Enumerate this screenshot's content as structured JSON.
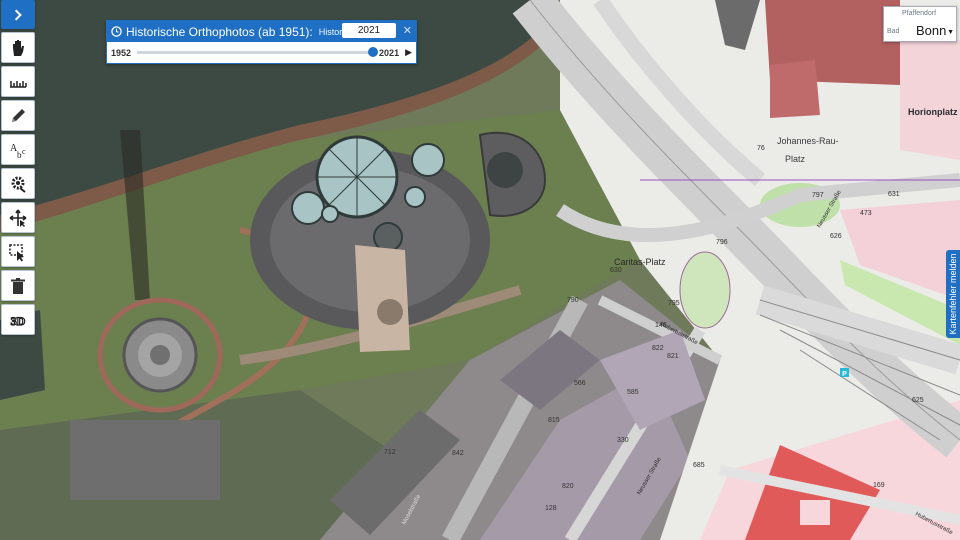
{
  "map": {
    "place_labels": {
      "johannes": "Johannes-Rau-",
      "platz": "Platz",
      "horionplatz": "Horionplatz",
      "caritas": "Caritas-Platz",
      "huberstrasse1": "Hubertusstraße",
      "huberstrasse2": "Hubertusstraße",
      "neusser1": "Neusser Straße",
      "neusser2": "Neusser Straße",
      "mosel": "Moselstraße"
    },
    "house_numbers": [
      "631",
      "473",
      "626",
      "797",
      "796",
      "795",
      "146",
      "822",
      "821",
      "585",
      "566",
      "815",
      "330",
      "685",
      "625",
      "842",
      "712",
      "820",
      "128",
      "169",
      "790",
      "630",
      "76"
    ],
    "parking_label": "P"
  },
  "toolbar": {
    "tools": [
      "expand-icon",
      "hand-icon",
      "measure-icon",
      "pencil-icon",
      "text-icon",
      "settings-icon",
      "move-icon",
      "select-icon",
      "trash-icon",
      "3d-icon"
    ],
    "label_3d": "3D"
  },
  "historic": {
    "title": "Historische Orthophotos (ab 1951):",
    "selected_layer": "Historische Orth",
    "year": "2021",
    "start": "1952",
    "end": "2021",
    "position": 1.0,
    "close": "✕",
    "play": "▶"
  },
  "city": {
    "name": "Bonn",
    "sub": "Pfaffendorf",
    "bad": "Bad",
    "caret": "▼"
  },
  "report": {
    "label": "Kartenfehler melden"
  },
  "colors": {
    "accent": "#1f6fc5"
  }
}
